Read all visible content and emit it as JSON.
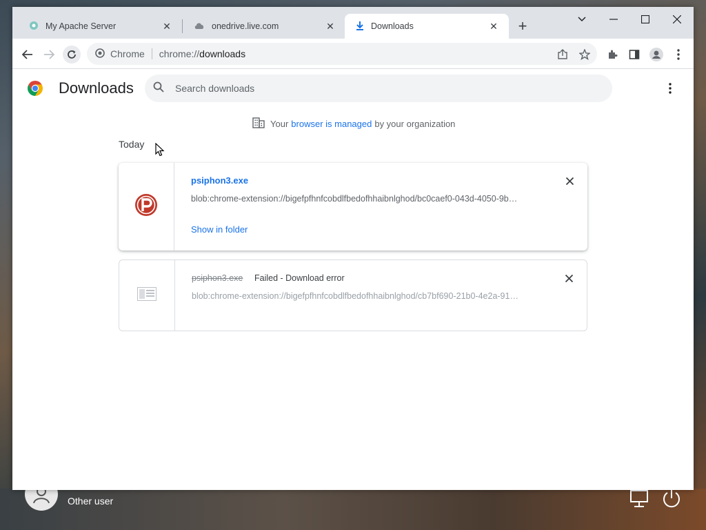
{
  "tabs": [
    {
      "title": "My Apache Server",
      "icon": "globe-icon",
      "active": false
    },
    {
      "title": "onedrive.live.com",
      "icon": "cloud-icon",
      "active": false
    },
    {
      "title": "Downloads",
      "icon": "download-icon",
      "active": true
    }
  ],
  "omnibox": {
    "site_label": "Chrome",
    "url_scheme": "chrome://",
    "url_host": "downloads"
  },
  "page": {
    "title": "Downloads",
    "search_placeholder": "Search downloads"
  },
  "managed": {
    "prefix": "Your",
    "link": "browser is managed",
    "suffix": "by your organization"
  },
  "section": "Today",
  "downloads": [
    {
      "file": "psiphon3.exe",
      "url": "blob:chrome-extension://bigefpfhnfcobdlfbedofhhaibnlghod/bc0caef0-043d-4050-9b…",
      "action": "Show in folder",
      "icon": "psiphon-icon"
    },
    {
      "file": "psiphon3.exe",
      "status": "Failed - Download error",
      "url": "blob:chrome-extension://bigefpfhnfcobdlfbedofhhaibnlghod/cb7bf690-21b0-4e2a-91…",
      "icon": "file-icon"
    }
  ],
  "desktop": {
    "user_name": "Other user"
  },
  "colors": {
    "accent": "#1a73e8",
    "tabstrip": "#dfe3e8",
    "psiphon": "#c0392b"
  }
}
